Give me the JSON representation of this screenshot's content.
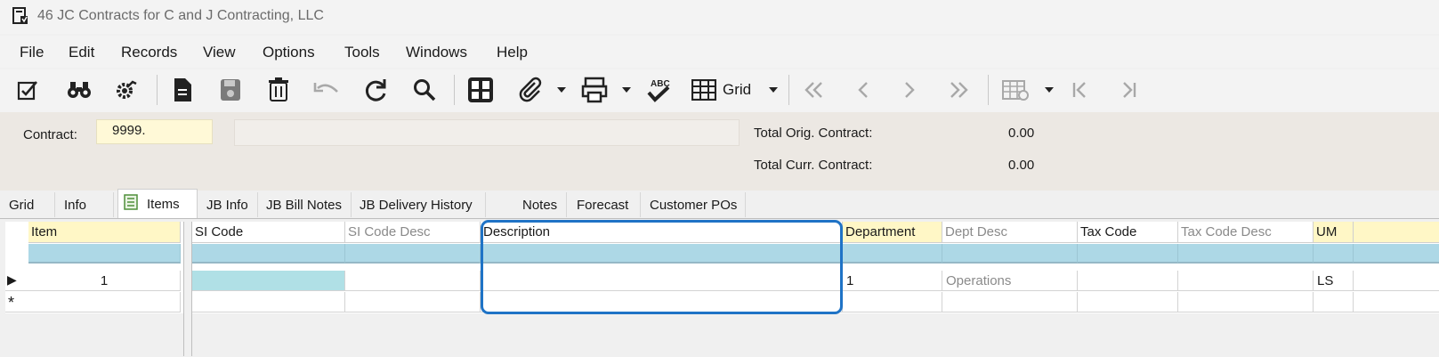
{
  "window": {
    "title": "46 JC Contracts for C and J Contracting, LLC",
    "icon": "form-icon"
  },
  "menu": [
    "File",
    "Edit",
    "Records",
    "View",
    "Options",
    "Tools",
    "Windows",
    "Help"
  ],
  "toolbar": {
    "view_mode_label": "Grid",
    "icons": [
      "edit-icon",
      "binoculars-icon",
      "settings-icon",
      "new-document-icon",
      "save-icon",
      "delete-icon",
      "undo-icon",
      "refresh-icon",
      "search-icon",
      "grid-layout-icon",
      "attachment-icon",
      "print-icon",
      "spellcheck-icon",
      "grid-icon",
      "first-record-icon",
      "previous-record-icon",
      "next-record-icon",
      "last-record-icon",
      "grid-settings-icon",
      "go-first-icon",
      "go-last-icon"
    ]
  },
  "header": {
    "contract_label": "Contract:",
    "contract_value": "9999.",
    "contract_description": "",
    "total_orig_label": "Total Orig. Contract:",
    "total_orig_value": "0.00",
    "total_curr_label": "Total Curr. Contract:",
    "total_curr_value": "0.00"
  },
  "tabs": [
    "Grid",
    "Info",
    "Items",
    "JB Info",
    "JB Bill Notes",
    "JB Delivery History",
    "Notes",
    "Forecast",
    "Customer POs"
  ],
  "active_tab": "Items",
  "grid": {
    "columns": {
      "item": "Item",
      "si_code": "SI Code",
      "si_code_desc": "SI Code Desc",
      "description": "Description",
      "department": "Department",
      "dept_desc": "Dept Desc",
      "tax_code": "Tax Code",
      "tax_code_desc": "Tax Code Desc",
      "um": "UM"
    },
    "row1": {
      "item": "1",
      "si_code": "",
      "si_code_desc": "",
      "description": "",
      "department": "1",
      "dept_desc": "Operations",
      "tax_code": "",
      "tax_code_desc": "",
      "um": "LS"
    },
    "new_row_marker": "*",
    "current_row_marker": "▶"
  },
  "colors": {
    "highlight": "#1f73c6",
    "filter_row": "#add8e6",
    "required_header": "#fff7c6",
    "contract_field": "#fff9d7"
  }
}
